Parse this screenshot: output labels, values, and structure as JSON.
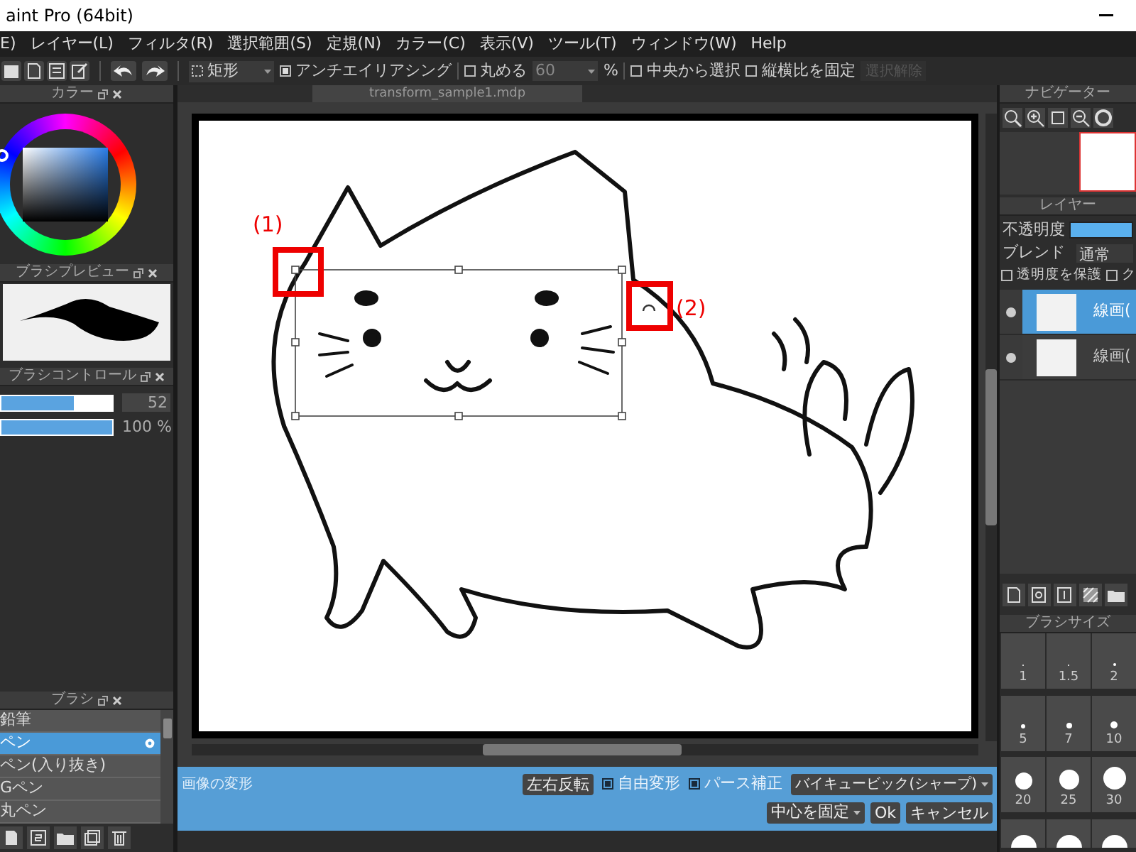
{
  "window": {
    "title": "aint Pro (64bit)"
  },
  "menu": [
    "E)",
    "レイヤー(L)",
    "フィルタ(R)",
    "選択範囲(S)",
    "定規(N)",
    "カラー(C)",
    "表示(V)",
    "ツール(T)",
    "ウィンドウ(W)",
    "Help"
  ],
  "toolbar": {
    "shape": "矩形",
    "antialias": {
      "label": "アンチエイリアシング",
      "checked": true
    },
    "round": {
      "label": "丸める",
      "checked": false,
      "value": "60",
      "unit": "%"
    },
    "from_center": {
      "label": "中央から選択",
      "checked": false
    },
    "fix_ratio": {
      "label": "縦横比を固定",
      "checked": false
    },
    "deselect": {
      "label": "選択解除",
      "disabled": true
    }
  },
  "color_panel": {
    "title": "カラー"
  },
  "brush_preview": {
    "title": "ブラシプレビュー"
  },
  "brush_control": {
    "title": "ブラシコントロール",
    "sliders": [
      {
        "level": 0.66,
        "reading": "52"
      },
      {
        "level": 1,
        "reading": "100 %"
      }
    ]
  },
  "brush_panel": {
    "title": "ブラシ",
    "items": [
      {
        "label": "鉛筆",
        "selected": false
      },
      {
        "label": "ペン",
        "selected": true
      },
      {
        "label": "ペン(入り抜き)",
        "selected": false
      },
      {
        "label": "Gペン",
        "selected": false
      },
      {
        "label": "丸ペン",
        "selected": false
      }
    ]
  },
  "document_tab": {
    "title": "transform_sample1.mdp"
  },
  "canvas": {
    "callouts": [
      "(1)",
      "(2)"
    ]
  },
  "navigator": {
    "title": "ナビゲーター"
  },
  "layers": {
    "title": "レイヤー",
    "opacity": {
      "label": "不透明度",
      "level": 1
    },
    "blend_label": "ブレンド",
    "blend": "通常",
    "protect": {
      "label": "透明度を保護",
      "checked": false
    },
    "clip": {
      "label": "ク",
      "checked": false
    },
    "items": [
      {
        "name": "線画(",
        "selected": true
      },
      {
        "name": "線画(",
        "selected": false
      }
    ]
  },
  "brush_size": {
    "title": "ブラシサイズ",
    "sizes": [
      "1",
      "1.5",
      "2",
      "5",
      "7",
      "10",
      "20",
      "25",
      "30"
    ]
  },
  "transform_bar": {
    "title": "画像の変形",
    "flip": "左右反転",
    "free": {
      "label": "自由変形",
      "checked": true
    },
    "perspective": {
      "label": "パース補正",
      "checked": true
    },
    "interpolation": "バイキュービック(シャープ)",
    "anchor": "中心を固定",
    "ok": "Ok",
    "cancel": "キャンセル"
  }
}
